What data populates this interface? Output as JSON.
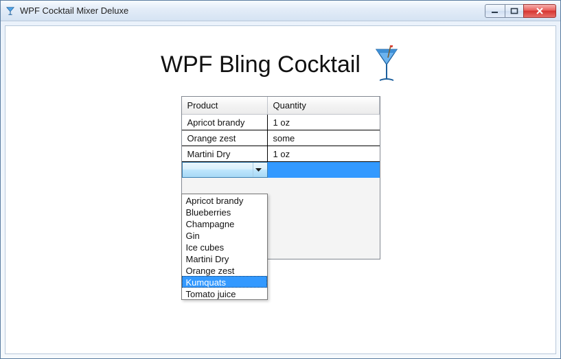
{
  "window": {
    "title": "WPF Cocktail Mixer Deluxe"
  },
  "heading": "WPF Bling Cocktail",
  "grid": {
    "headers": {
      "product": "Product",
      "quantity": "Quantity"
    },
    "rows": [
      {
        "product": "Apricot brandy",
        "quantity": "1 oz"
      },
      {
        "product": "Orange zest",
        "quantity": "some"
      },
      {
        "product": "Martini Dry",
        "quantity": "1 oz"
      }
    ]
  },
  "dropdown": {
    "items": [
      "Apricot brandy",
      "Blueberries",
      "Champagne",
      "Gin",
      "Ice cubes",
      "Martini Dry",
      "Orange zest",
      "Kumquats",
      "Tomato juice"
    ],
    "highlighted": "Kumquats"
  }
}
